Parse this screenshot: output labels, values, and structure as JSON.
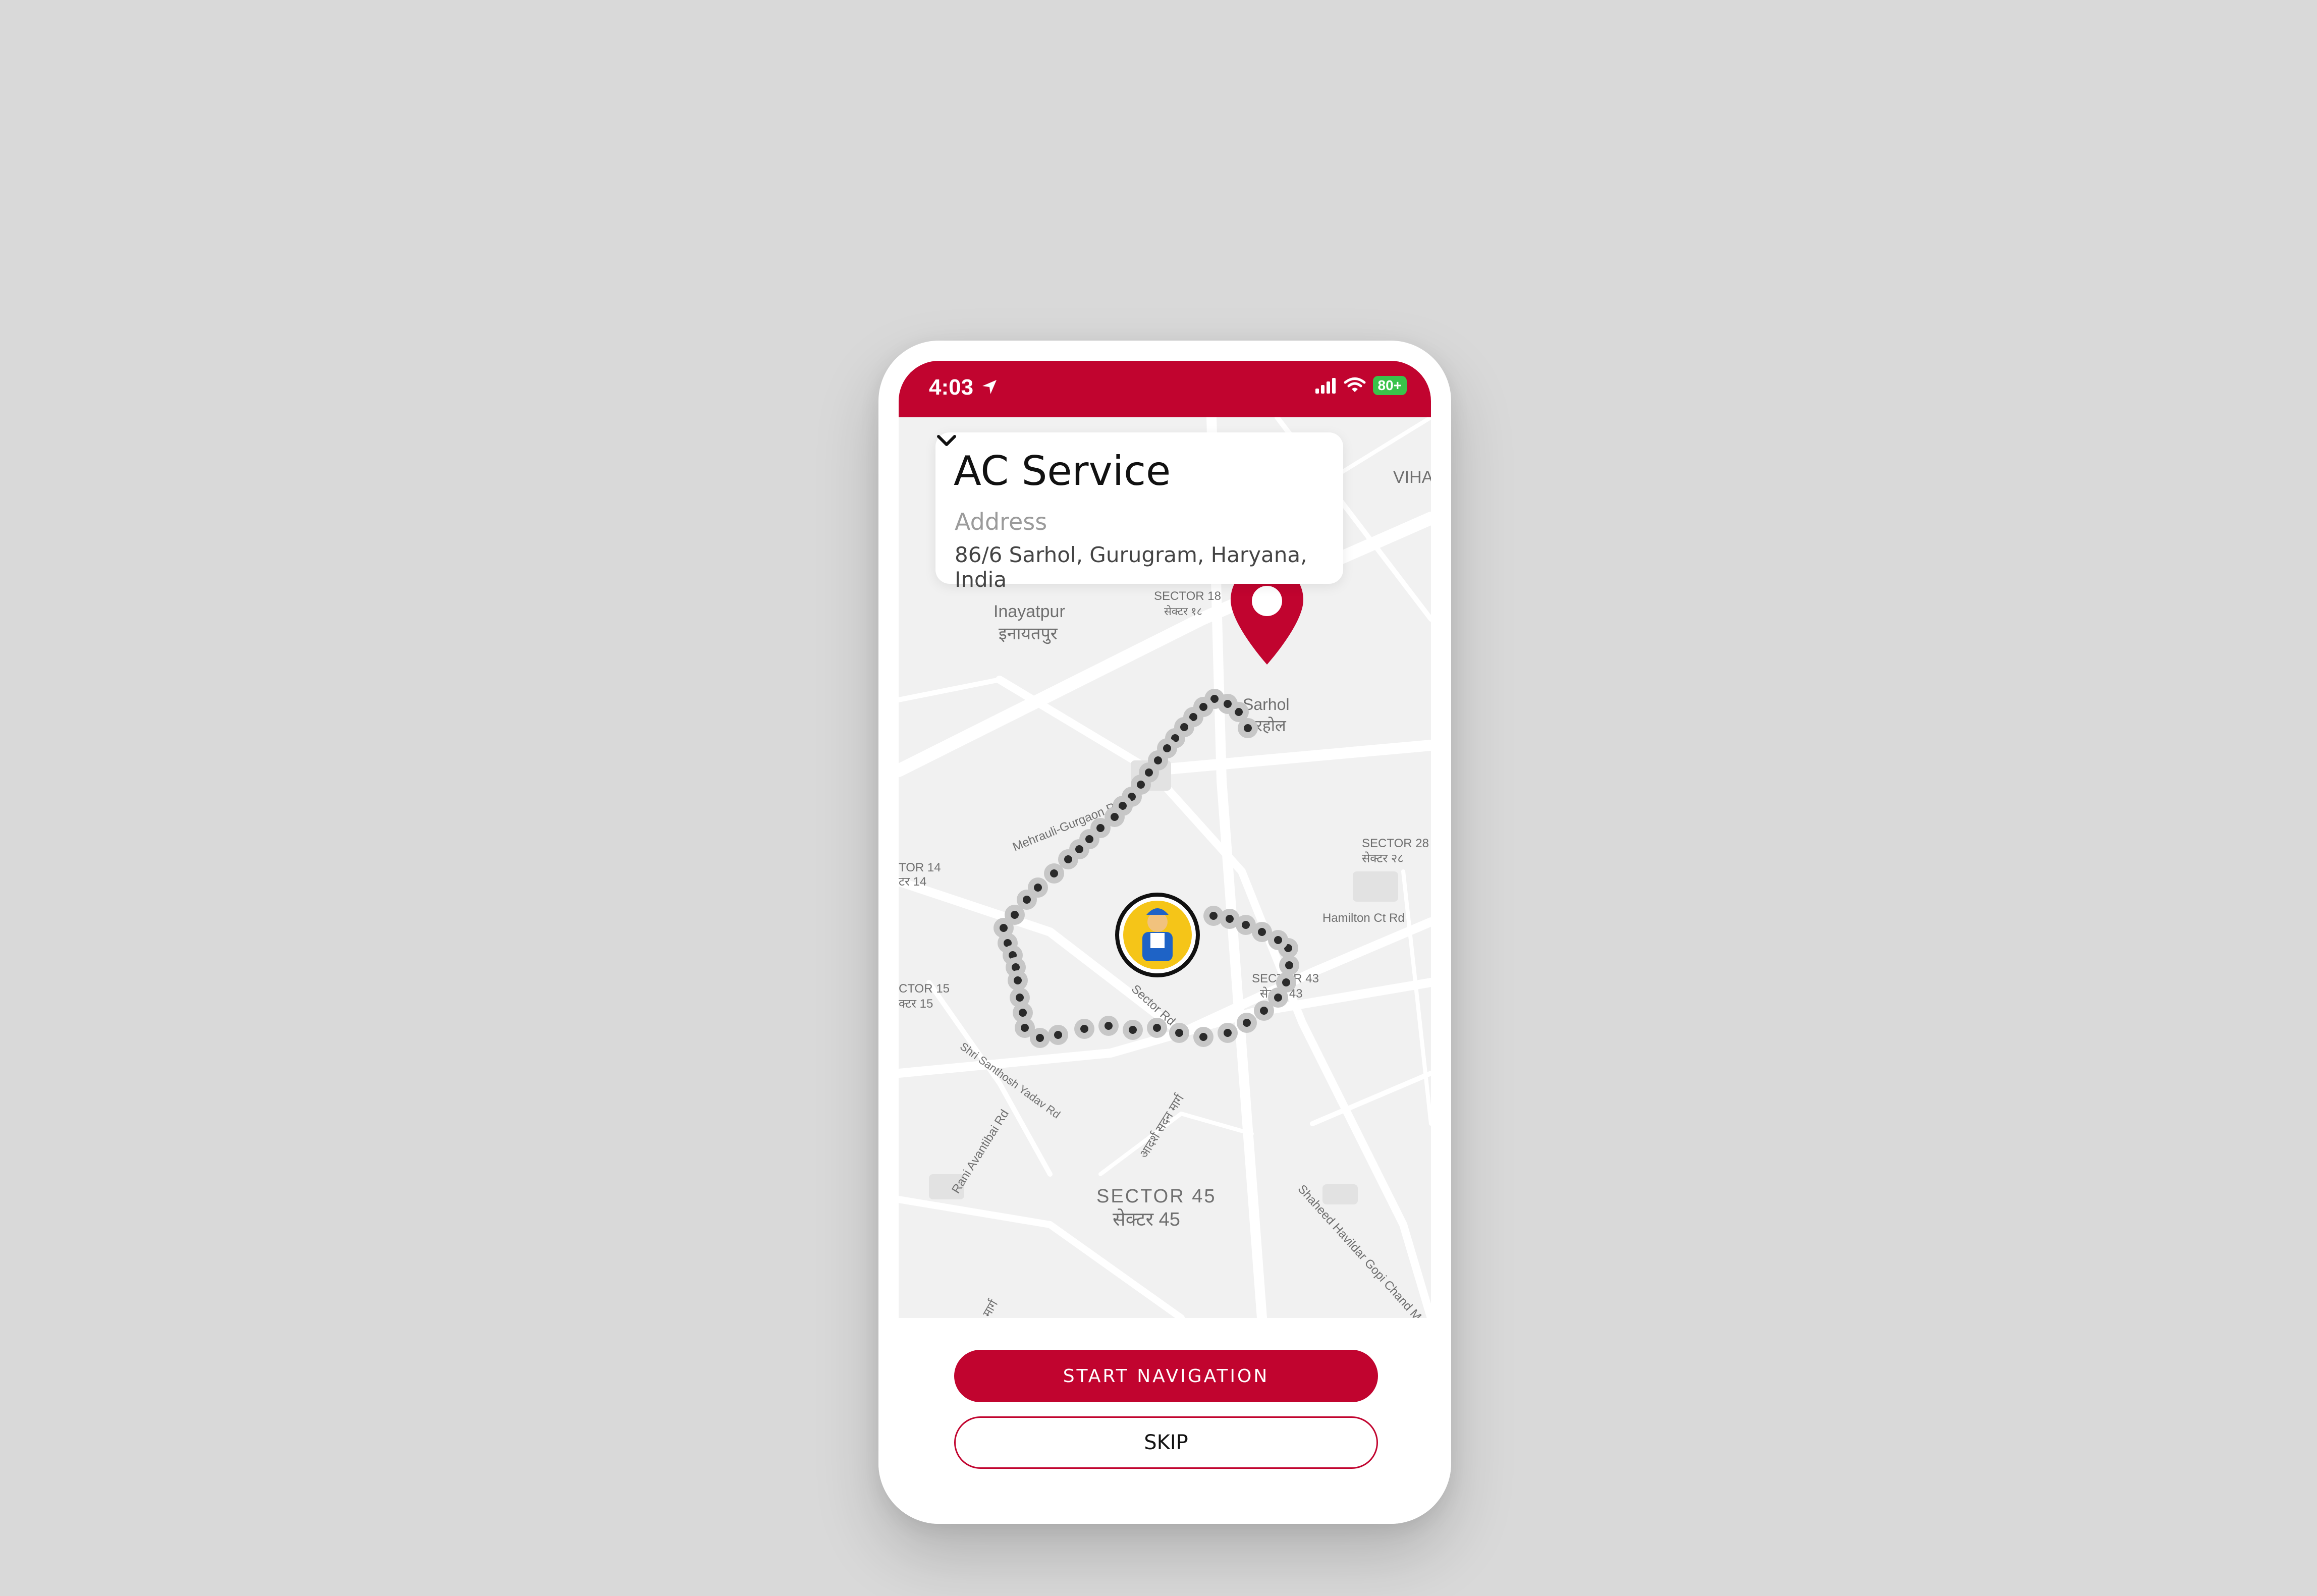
{
  "status_bar": {
    "time": "4:03",
    "battery": "80+",
    "icons": [
      "location-arrow-icon",
      "cellular-signal-icon",
      "wifi-icon",
      "battery-icon"
    ]
  },
  "card": {
    "title": "AC Service",
    "address_label": "Address",
    "address_value": "86/6 Sarhol, Gurugram, Haryana, India",
    "chevron_icon": "chevron-down-icon"
  },
  "map": {
    "labels": {
      "inayatpur_en": "Inayatpur",
      "inayatpur_hi": "इनायतपुर",
      "sector18_en": "SECTOR 18",
      "sector18_hi": "सेक्टर १८",
      "sarhol_en": "Sarhol",
      "sarhol_hi": "सरहोल",
      "road_gurgaon": "Mehrauli-Gurgaon Rd",
      "sector14_en": "TOR 14",
      "sector14_hi": "टर 14",
      "sector15_en": "CTOR 15",
      "sector15_hi": "क्टर 15",
      "sector_rd": "Sector Rd",
      "sector43_en": "SECTOR 43",
      "sector43_hi": "सेक्टर 43",
      "hamilton": "Hamilton Ct Rd",
      "sector28_en": "SECTOR 28",
      "sector28_hi": "सेक्टर २८",
      "santosh": "Shri Santhosh Yadav Rd",
      "adarsh": "आदर्श सदन मार्ग",
      "rani": "Rani Avantibai Rd",
      "sector45_en": "SECTOR 45",
      "sector45_hi": "सेक्टर 45",
      "shaheed": "Shaheed Havildar Gopi Chand Ma",
      "vihar": "VIHA",
      "marg": "मार्ग"
    },
    "destination_icon": "map-pin-icon",
    "technician_icon": "technician-avatar-icon",
    "accent": "#c1042f"
  },
  "actions": {
    "start_navigation": "START NAVIGATION",
    "skip": "SKIP"
  },
  "colors": {
    "brand": "#c1042f",
    "route_dot": "#c7c7c7"
  }
}
